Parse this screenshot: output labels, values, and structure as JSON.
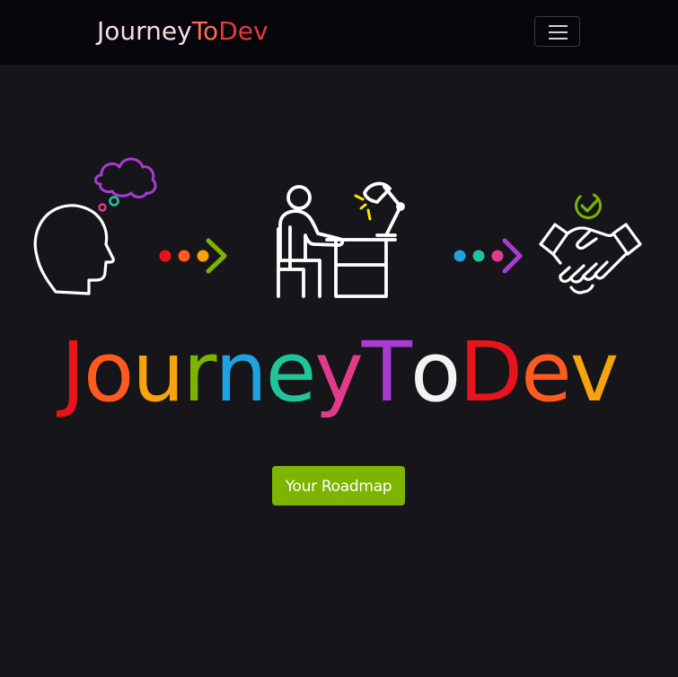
{
  "navbar": {
    "brand": {
      "part1": "Journey",
      "part2": "To",
      "part3": "Dev"
    },
    "toggler_icon": "hamburger-icon"
  },
  "hero": {
    "illustrations": [
      "head-thinking-icon",
      "arrow-dots-icon",
      "person-at-desk-icon",
      "arrow-dots-icon",
      "handshake-icon"
    ],
    "title_letters": [
      {
        "char": "J",
        "color": "#e8141b"
      },
      {
        "char": "o",
        "color": "#ff5b1f"
      },
      {
        "char": "u",
        "color": "#f5a30e"
      },
      {
        "char": "r",
        "color": "#7cb400"
      },
      {
        "char": "n",
        "color": "#1fa3e0"
      },
      {
        "char": "e",
        "color": "#1fc59a"
      },
      {
        "char": "y",
        "color": "#e13c8c"
      },
      {
        "char": "T",
        "color": "#a93bd4"
      },
      {
        "char": "o",
        "color": "#f3f3f3"
      },
      {
        "char": "D",
        "color": "#e8141b"
      },
      {
        "char": "e",
        "color": "#ff5b1f"
      },
      {
        "char": "v",
        "color": "#f5a30e"
      }
    ],
    "cta_label": "Your Roadmap",
    "cta_color": "#7cb400"
  }
}
